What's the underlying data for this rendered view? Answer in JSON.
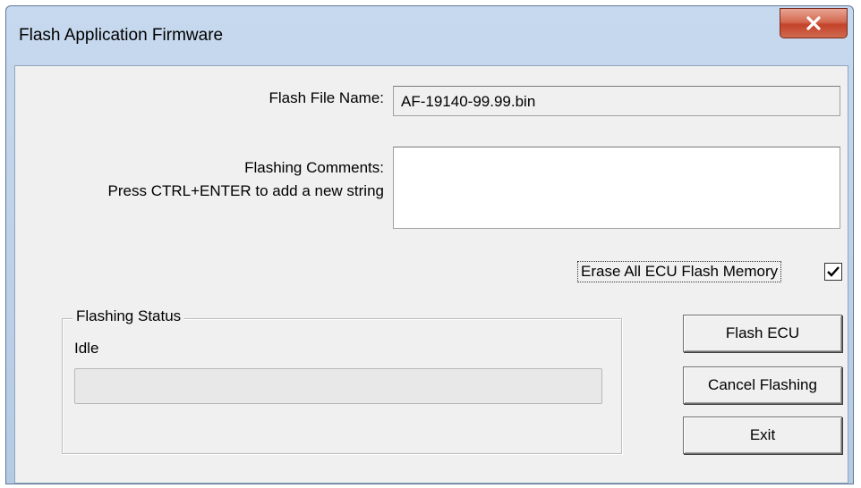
{
  "window": {
    "title": "Flash Application Firmware",
    "close_glyph": "X"
  },
  "form": {
    "flash_file_label": "Flash File Name:",
    "flash_file_value": "AF-19140-99.99.bin",
    "comments_label": "Flashing Comments:",
    "comments_hint": "Press CTRL+ENTER to add a new string",
    "comments_value": "",
    "erase_label": "Erase All ECU Flash Memory",
    "erase_checked": true
  },
  "status": {
    "group_title": "Flashing Status",
    "state_text": "Idle",
    "progress_percent": 0
  },
  "buttons": {
    "flash_label": "Flash ECU",
    "cancel_label": "Cancel Flashing",
    "exit_label": "Exit"
  },
  "colors": {
    "client_bg": "#f0f0f0",
    "close_button": "#c4432a",
    "title_bar": "#c7d9ee"
  }
}
